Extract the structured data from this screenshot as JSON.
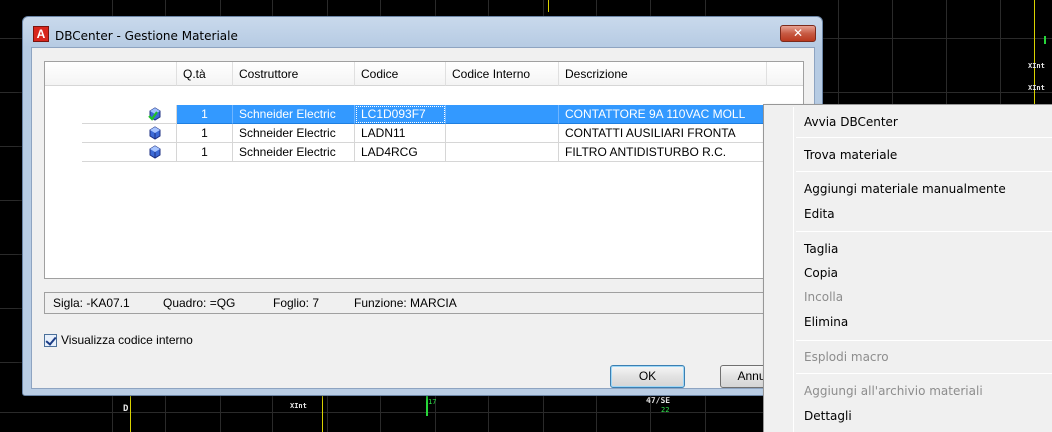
{
  "cad": {
    "label_d": "D",
    "label_47se": "47/SE",
    "label_22": "22",
    "label_17": "17",
    "label_xint1": "XInt",
    "label_xint2": "XInt",
    "label_xint3": "XInt"
  },
  "window": {
    "title": "DBCenter - Gestione Materiale",
    "close_glyph": "✕"
  },
  "table": {
    "columns": [
      "",
      "Q.tà",
      "Costruttore",
      "Codice",
      "Codice Interno",
      "Descrizione"
    ],
    "rows": [
      {
        "qty": "1",
        "maker": "Schneider Electric",
        "code": "LC1D093F7",
        "internal": "",
        "desc": "CONTATTORE 9A 110VAC MOLL",
        "icon": "material-added-icon"
      },
      {
        "qty": "1",
        "maker": "Schneider Electric",
        "code": "LADN11",
        "internal": "",
        "desc": "CONTATTI AUSILIARI FRONTA",
        "icon": "material-icon"
      },
      {
        "qty": "1",
        "maker": "Schneider Electric",
        "code": "LAD4RCG",
        "internal": "",
        "desc": "FILTRO ANTIDISTURBO R.C.",
        "icon": "material-icon"
      }
    ]
  },
  "status": {
    "sigla": "Sigla: -KA07.1",
    "quadro": "Quadro: =QG",
    "foglio": "Foglio: 7",
    "funzione": "Funzione: MARCIA"
  },
  "checkbox": {
    "label": "Visualizza codice interno",
    "checked": true
  },
  "buttons": {
    "ok": "OK",
    "cancel": "Annulla"
  },
  "context_menu": {
    "items": [
      {
        "label": "Avvia DBCenter",
        "enabled": true
      },
      {
        "label": "Trova materiale",
        "enabled": true
      },
      {
        "label": "Aggiungi materiale manualmente",
        "enabled": true
      },
      {
        "label": "Edita",
        "enabled": true
      },
      {
        "label": "Taglia",
        "enabled": true
      },
      {
        "label": "Copia",
        "enabled": true
      },
      {
        "label": "Incolla",
        "enabled": false
      },
      {
        "label": "Elimina",
        "enabled": true
      },
      {
        "label": "Esplodi macro",
        "enabled": false
      },
      {
        "label": "Aggiungi all'archivio materiali",
        "enabled": false
      },
      {
        "label": "Dettagli",
        "enabled": true
      }
    ]
  },
  "colors": {
    "selection": "#3399ff",
    "cad_background": "#000000",
    "cad_yellow": "#d9d200",
    "cad_green": "#27d63a"
  }
}
